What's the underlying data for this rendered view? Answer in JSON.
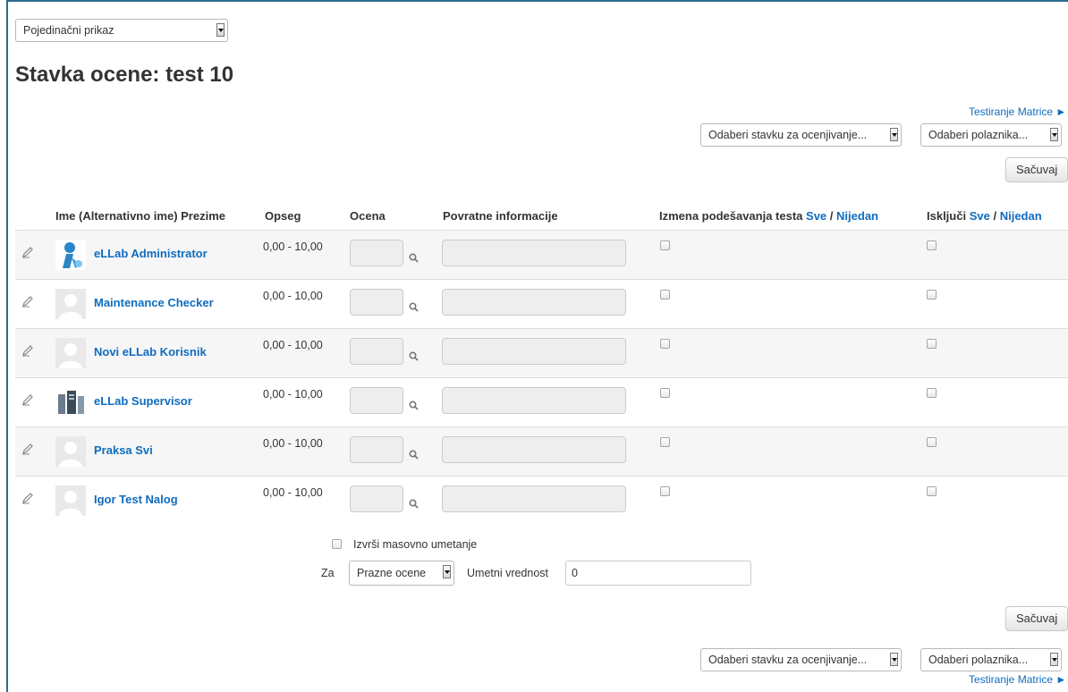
{
  "view_select": {
    "value": "Pojedinačni prikaz"
  },
  "page_title": "Stavka ocene: test 10",
  "breadcrumb_link": "Testiranje Matrice ►",
  "top_controls": {
    "grade_item_select": "Odaberi stavku za ocenjivanje...",
    "student_select": "Odaberi polaznika...",
    "save_label": "Sačuvaj"
  },
  "table": {
    "headers": {
      "name": "Ime (Alternativno ime) Prezime",
      "range": "Opseg",
      "grade": "Ocena",
      "feedback": "Povratne informacije",
      "override": "Izmena podešavanja testa",
      "exclude": "Isključi",
      "all": "Sve",
      "sep": "/",
      "none": "Nijedan"
    },
    "rows": [
      {
        "name": "eLLab Administrator",
        "range": "0,00 - 10,00",
        "avatar": "admin-avatar"
      },
      {
        "name": "Maintenance Checker",
        "range": "0,00 - 10,00",
        "avatar": "default-avatar"
      },
      {
        "name": "Novi eLLab Korisnik",
        "range": "0,00 - 10,00",
        "avatar": "default-avatar"
      },
      {
        "name": "eLLab Supervisor",
        "range": "0,00 - 10,00",
        "avatar": "supervisor-avatar"
      },
      {
        "name": "Praksa Svi",
        "range": "0,00 - 10,00",
        "avatar": "default-avatar"
      },
      {
        "name": "Igor Test Nalog",
        "range": "0,00 - 10,00",
        "avatar": "default-avatar"
      }
    ]
  },
  "bulk": {
    "checkbox_label": "Izvrši masovno umetanje",
    "for_label": "Za",
    "for_select": "Prazne ocene",
    "insert_label": "Umetni vrednost",
    "insert_value": "0"
  },
  "bottom_controls": {
    "save_label": "Sačuvaj",
    "grade_item_select": "Odaberi stavku za ocenjivanje...",
    "student_select": "Odaberi polaznika...",
    "footer_link": "Testiranje Matrice ►"
  },
  "colors": {
    "link": "#0f6cbf",
    "frame": "#2e6c8e",
    "stripe": "#f6f6f6"
  }
}
